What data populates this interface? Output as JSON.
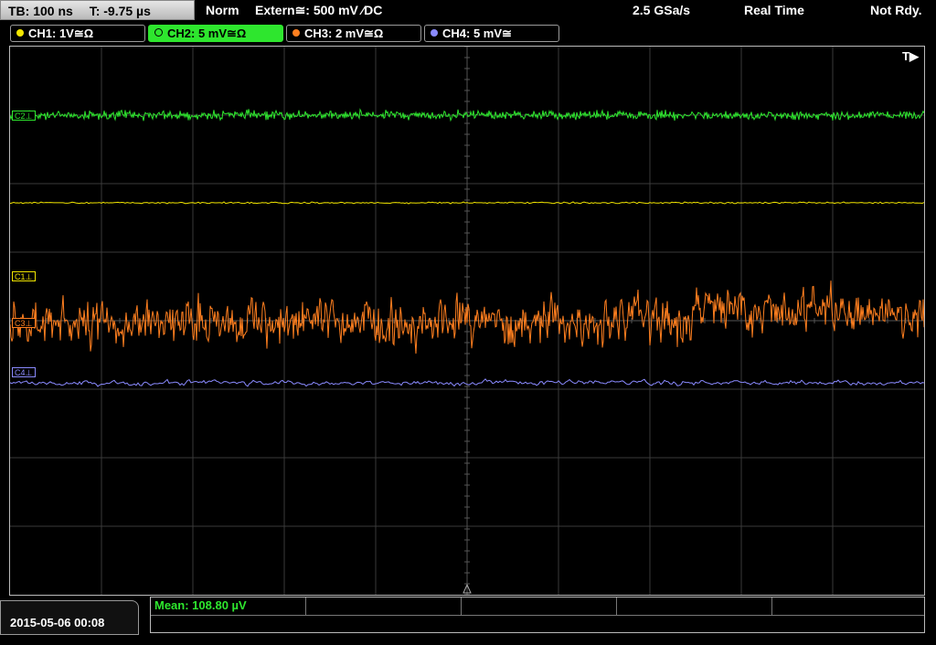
{
  "topbar": {
    "timebase": "TB: 100 ns",
    "trigger_time": "T: -9.75 µs",
    "trigger_mode": "Norm",
    "trigger_source": "Extern≅: 500 mV ⁄DC",
    "sample_rate": "2.5 GSa/s",
    "acq_mode": "Real Time",
    "status": "Not Rdy."
  },
  "channels": [
    {
      "label": "CH1: 1V≅Ω",
      "color": "#f2e600",
      "active": false
    },
    {
      "label": "CH2: 5 mV≅Ω",
      "color": "#2ee62e",
      "active": true
    },
    {
      "label": "CH3: 2 mV≅Ω",
      "color": "#ff7f1f",
      "active": false
    },
    {
      "label": "CH4: 5 mV≅",
      "color": "#8a8aff",
      "active": false
    }
  ],
  "screen": {
    "trigger_marker": "T▶",
    "markers": {
      "c1": "C1⊥",
      "c2": "C2⊥",
      "c3": "C3⊥",
      "c4": "C4⊥"
    }
  },
  "bottom": {
    "datetime": "2015-05-06 00:08",
    "mean": "Mean: 108.80 µV"
  }
}
